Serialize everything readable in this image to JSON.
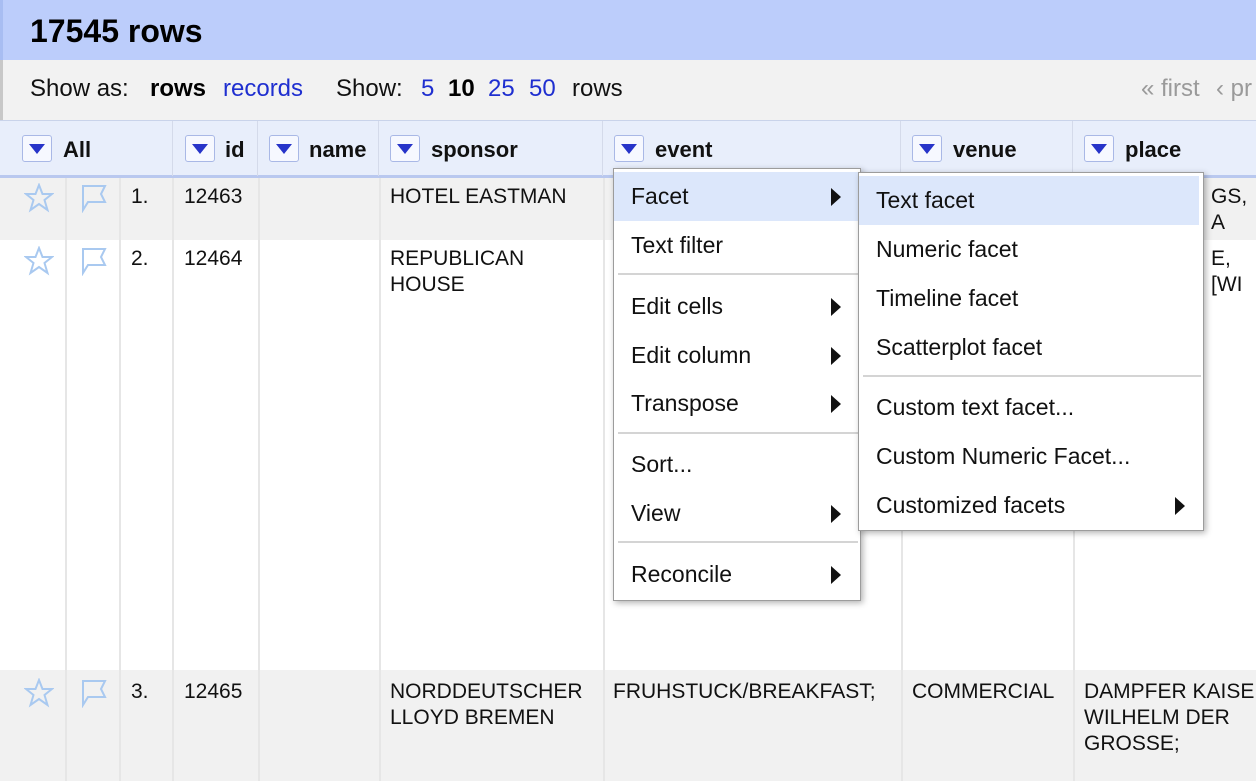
{
  "header": {
    "row_count": "17545 rows"
  },
  "toolbar": {
    "show_as_label": "Show as:",
    "rows_mode": "rows",
    "records_mode": "records",
    "show_label": "Show:",
    "page_sizes": [
      "5",
      "10",
      "25",
      "50"
    ],
    "page_size_selected": "10",
    "rows_suffix": "rows",
    "first_label": "« first",
    "prev_label": "‹ pr"
  },
  "columns": [
    {
      "label": "All"
    },
    {
      "label": "id"
    },
    {
      "label": "name"
    },
    {
      "label": "sponsor"
    },
    {
      "label": "event"
    },
    {
      "label": "venue"
    },
    {
      "label": "place"
    }
  ],
  "rows": [
    {
      "index": "1.",
      "id": "12463",
      "name": "",
      "sponsor": "HOTEL EASTMAN",
      "event": "",
      "venue": "",
      "place": "GS, A"
    },
    {
      "index": "2.",
      "id": "12464",
      "name": "",
      "sponsor": "REPUBLICAN\nHOUSE",
      "event": "",
      "venue": "",
      "place": "E, [WI"
    },
    {
      "index": "3.",
      "id": "12465",
      "name": "",
      "sponsor": "NORDDEUTSCHER\nLLOYD BREMEN",
      "event": "FRUHSTUCK/BREAKFAST;",
      "venue": "COMMERCIAL",
      "place": "DAMPFER KAISE\nWILHELM DER\nGROSSE;"
    }
  ],
  "column_menu": {
    "items": [
      {
        "label": "Facet",
        "submenu": true
      },
      {
        "label": "Text filter",
        "submenu": false
      },
      {
        "label": "Edit cells",
        "submenu": true
      },
      {
        "label": "Edit column",
        "submenu": true
      },
      {
        "label": "Transpose",
        "submenu": true
      },
      {
        "label": "Sort...",
        "submenu": false
      },
      {
        "label": "View",
        "submenu": true
      },
      {
        "label": "Reconcile",
        "submenu": true
      }
    ]
  },
  "facet_submenu": {
    "items": [
      {
        "label": "Text facet"
      },
      {
        "label": "Numeric facet"
      },
      {
        "label": "Timeline facet"
      },
      {
        "label": "Scatterplot facet"
      },
      {
        "label": "Custom text facet..."
      },
      {
        "label": "Custom Numeric Facet..."
      },
      {
        "label": "Customized facets"
      }
    ]
  },
  "colors": {
    "header_bg": "#bccdfb",
    "link": "#1f2fd0",
    "menu_highlight": "#dce7fb",
    "dropdown_arrow": "#2734c9"
  },
  "icons": {
    "star": "star-icon",
    "flag": "flag-icon",
    "dropdown": "triangle-down-icon",
    "submenu": "triangle-right-icon"
  }
}
